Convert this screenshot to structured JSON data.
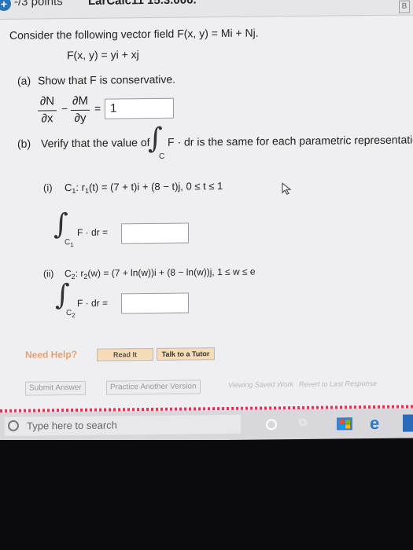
{
  "header": {
    "points_label": "-/3 points",
    "problem_id": "LarCalc11 15.3.006."
  },
  "question": {
    "intro": "Consider the following vector field F(x, y) = Mi + Nj.",
    "field": "F(x, y) = yi + xj",
    "part_a": {
      "label": "(a)",
      "text": "Show that F is conservative.",
      "dN": "∂N",
      "dx": "∂x",
      "dM": "∂M",
      "dy": "∂y",
      "minus": "−",
      "equals": "=",
      "answer_value": "1"
    },
    "part_b": {
      "label": "(b)",
      "text_before": "Verify that the value of",
      "integral_sub": "C",
      "text_after": "F · dr is the same for each parametric representation c",
      "i": {
        "label": "(i)",
        "curve": "C",
        "curve_sub": "1",
        "colon_r": ": r",
        "r_sub": "1",
        "param": "(t) = (7 + t)i + (8 − t)j,  0 ≤ t ≤ 1",
        "integral_sub": "C",
        "integral_sub2": "1",
        "integrand": "F · dr =",
        "answer_value": ""
      },
      "ii": {
        "label": "(ii)",
        "curve": "C",
        "curve_sub": "2",
        "colon_r": ": r",
        "r_sub": "2",
        "param": "(w) = (7 + ln(w))i + (8 − ln(w))j,  1 ≤ w ≤ e",
        "integral_sub": "C",
        "integral_sub2": "2",
        "integrand": "F · dr =",
        "answer_value": ""
      }
    }
  },
  "help": {
    "need_help": "Need Help?",
    "read_it": "Read It",
    "talk_to_tutor": "Talk to a Tutor"
  },
  "actions": {
    "submit": "Submit Answer",
    "practice": "Practice Another Version",
    "viewing_saved": "Viewing Saved Work",
    "revert": "Revert to Last Response"
  },
  "taskbar": {
    "search_placeholder": "Type here to search"
  }
}
